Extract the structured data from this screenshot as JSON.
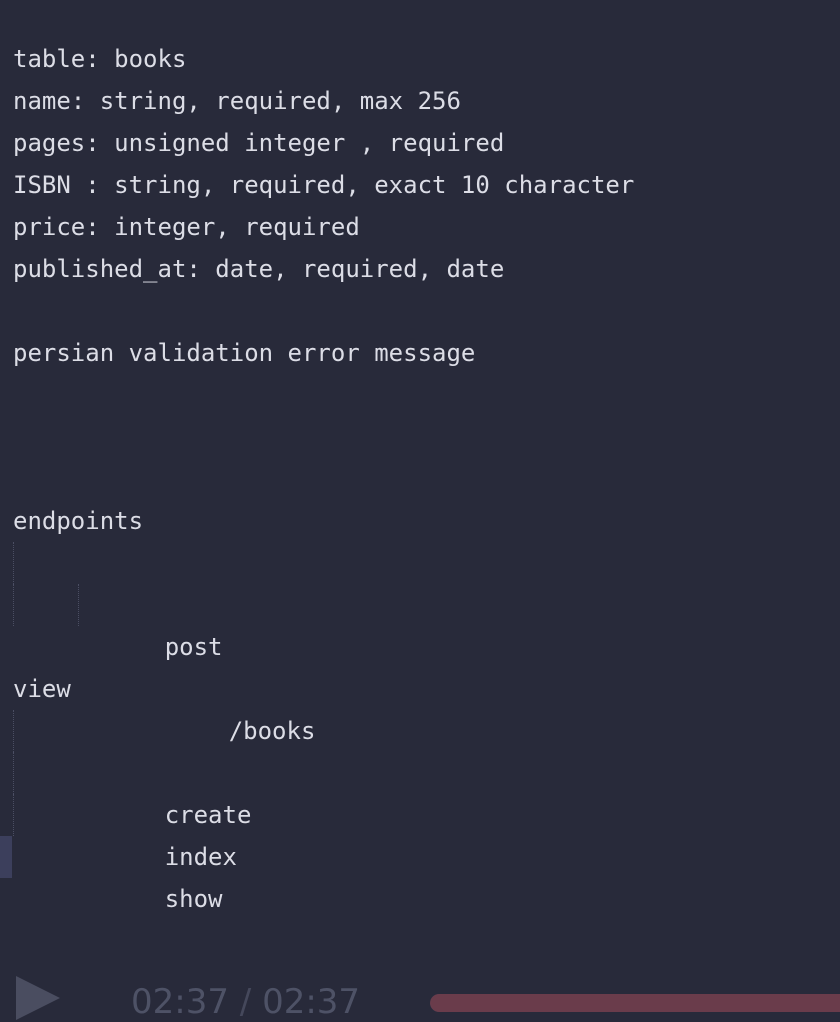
{
  "editor": {
    "lines": [
      {
        "text": "table: books",
        "indent": 0
      },
      {
        "text": "name: string, required, max 256",
        "indent": 0
      },
      {
        "text": "pages: unsigned integer , required",
        "indent": 0
      },
      {
        "text": "ISBN : string, required, exact 10 character",
        "indent": 0
      },
      {
        "text": "price: integer, required",
        "indent": 0
      },
      {
        "text": "published_at: date, required, date",
        "indent": 0
      },
      {
        "text": "",
        "indent": 0
      },
      {
        "text": "persian validation error message",
        "indent": 0
      },
      {
        "text": "",
        "indent": 0
      },
      {
        "text": "",
        "indent": 0
      },
      {
        "text": "",
        "indent": 0
      },
      {
        "text": "endpoints",
        "indent": 0
      },
      {
        "text": "post",
        "indent": 1
      },
      {
        "text": "/books",
        "indent": 2
      },
      {
        "text": "",
        "indent": 0
      },
      {
        "text": "view",
        "indent": 0
      },
      {
        "text": "create",
        "indent": 1
      },
      {
        "text": "index",
        "indent": 1
      },
      {
        "text": "show",
        "indent": 1
      }
    ]
  },
  "player": {
    "current_time": "02:37",
    "separator": " / ",
    "total_time": "02:37",
    "progress": 1.0,
    "play_icon": "play-icon"
  },
  "colors": {
    "background": "#282a3a",
    "text": "#dcdde6",
    "progress_fill": "#6a3c4b"
  }
}
